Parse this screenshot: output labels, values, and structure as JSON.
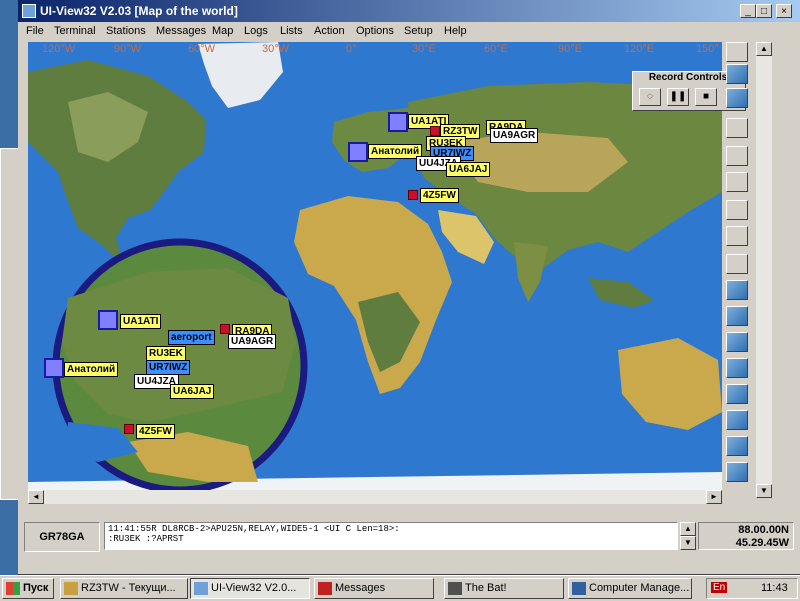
{
  "window": {
    "title": "UI-View32 V2.03 [Map of the world]"
  },
  "menu": [
    "File",
    "Terminal",
    "Stations",
    "Messages",
    "Map",
    "Logs",
    "Lists",
    "Action",
    "Options",
    "Setup",
    "Help"
  ],
  "grid_labels": [
    "120°W",
    "90°W",
    "60°W",
    "30°W",
    "0°",
    "30°E",
    "60°E",
    "90°E",
    "120°E",
    "150°"
  ],
  "stations": {
    "ua1ati": "UA1ATI",
    "rz3tw": "RZ3TW",
    "ra9da": "RA9DA",
    "ua9agr": "UA9AGR",
    "ru3ek": "RU3EK",
    "ur7iwz": "UR7IWZ",
    "anatoliy": "Анатолий",
    "uu4jza": "UU4JZA",
    "ua6jaj": "UA6JAJ",
    "z4fw": "4Z5FW",
    "aeroport": "aeroport"
  },
  "record_controls": {
    "title": "Record Controls"
  },
  "status": {
    "grid_locator": "GR78GA",
    "console_line1": "11:41:55R DL8RCB-2>APU25N,RELAY,WIDE5-1 <UI C Len=18>:",
    "console_line2": ":RU3EK    :?APRST",
    "lat": "88.00.00N",
    "lon": "45.29.45W"
  },
  "taskbar": {
    "start": "Пуск",
    "items": [
      "RZ3TW - Текущи...",
      "UI-View32 V2.0...",
      "Messages",
      "The Bat!",
      "Computer Manage..."
    ],
    "clock": "11:43",
    "lang": "En"
  },
  "colors": {
    "ocean": "#2f78cf",
    "title_start": "#0a246a",
    "title_end": "#a6caf0",
    "label_yellow": "#ffff66",
    "zoom_ring": "#1a1a80"
  },
  "icons": [
    "app-icon",
    "minimize-icon",
    "maximize-icon",
    "close-icon",
    "pause-icon",
    "stop-icon",
    "record-icon"
  ]
}
